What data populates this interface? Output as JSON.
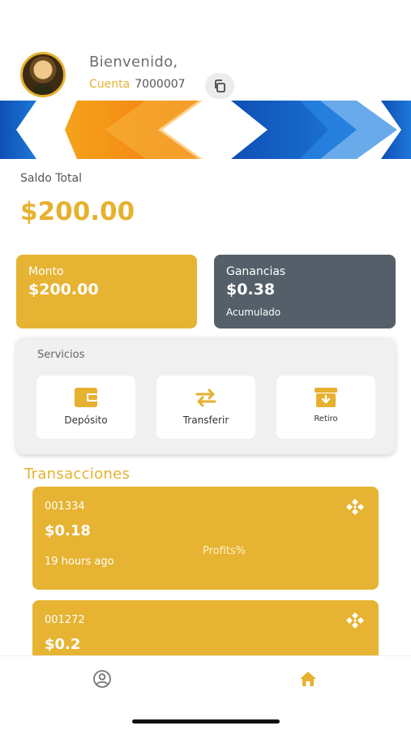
{
  "header": {
    "welcome": "Bienvenido,",
    "account_label": "Cuenta",
    "account_number": "7000007"
  },
  "balance": {
    "label": "Saldo Total",
    "value": "$200.00"
  },
  "cards": {
    "monto": {
      "label": "Monto",
      "value": "$200.00"
    },
    "ganancias": {
      "label": "Ganancias",
      "value": "$0.38",
      "sub": "Acumulado"
    }
  },
  "services": {
    "title": "Servicios",
    "items": [
      {
        "label": "Depósito",
        "icon": "wallet-icon"
      },
      {
        "label": "Transferir",
        "icon": "swap-arrows-icon"
      },
      {
        "label": "Retiro",
        "icon": "archive-box-icon"
      }
    ]
  },
  "transactions": {
    "heading": "Transacciones",
    "items": [
      {
        "id": "001334",
        "amount": "$0.18",
        "time": "19 hours ago",
        "kind": "Profits%",
        "icon": "crypto-diamond-icon"
      },
      {
        "id": "001272",
        "amount": "$0.2",
        "icon": "crypto-diamond-icon"
      }
    ]
  },
  "nav": {
    "items": [
      {
        "icon": "profile-icon"
      },
      {
        "icon": "home-icon"
      }
    ]
  },
  "colors": {
    "accent": "#e6b12f",
    "card_dark": "#545f69",
    "banner_blue": "#1763c6",
    "banner_orange": "#f28a16"
  }
}
